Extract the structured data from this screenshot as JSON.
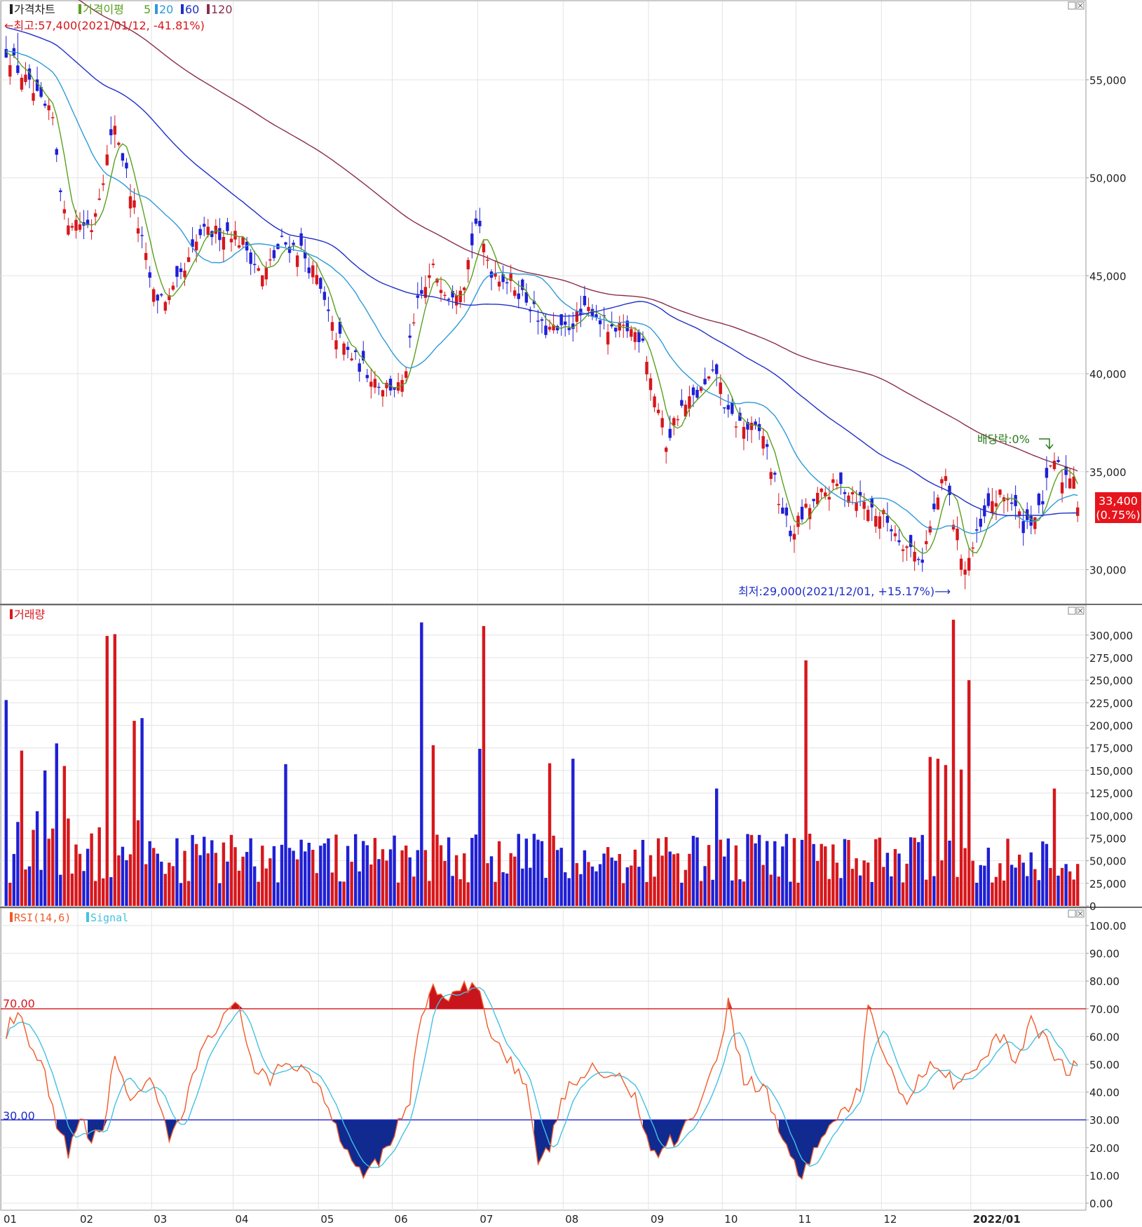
{
  "colors": {
    "up": "#d7171c",
    "down": "#1f1fd6",
    "ma5": "#5aa020",
    "ma20": "#2e9ad8",
    "ma60": "#1f2ec8",
    "ma120": "#8a2e4a",
    "rsi": "#f15a29",
    "signal": "#44c1e0",
    "over70": "#c8141c",
    "under30": "#102a90",
    "grid": "#e3e3e3",
    "frame": "#9a9a9a",
    "text": "#222222"
  },
  "price_panel": {
    "legend": {
      "chart_label": "가격차트",
      "ma_label": "가격이평",
      "ma5": "5",
      "ma20": "20",
      "ma60": "60",
      "ma120": "120"
    },
    "high_label": "←최고:57,400(2021/01/12, -41.81%)",
    "low_label": "최저:29,000(2021/12/01, +15.17%)⟶",
    "dividend_label": "배당락:0%",
    "current_price": "33,400",
    "current_change": "(0.75%)",
    "ytick_labels": [
      "55,000",
      "50,000",
      "45,000",
      "40,000",
      "35,000",
      "30,000"
    ]
  },
  "volume_panel": {
    "legend": "거래량",
    "ytick_labels": [
      "300,000",
      "275,000",
      "250,000",
      "225,000",
      "200,000",
      "175,000",
      "150,000",
      "125,000",
      "100,000",
      "75,000",
      "50,000",
      "25,000",
      "0"
    ]
  },
  "rsi_panel": {
    "legend_rsi": "RSI(14,6)",
    "legend_signal": "Signal",
    "level_70": "70.00",
    "level_30": "30.00",
    "ytick_labels": [
      "100.00",
      "90.00",
      "80.00",
      "70.00",
      "60.00",
      "50.00",
      "40.00",
      "30.00",
      "20.00",
      "10.00",
      "0.00"
    ]
  },
  "x_labels": [
    "01",
    "02",
    "03",
    "04",
    "05",
    "06",
    "07",
    "08",
    "09",
    "10",
    "11",
    "12",
    "2022/01"
  ],
  "chart_data": [
    {
      "type": "candlestick",
      "title": "가격차트",
      "ylim": [
        28300,
        58000
      ],
      "yticks": [
        30000,
        35000,
        40000,
        45000,
        50000,
        55000
      ],
      "x": [
        "2021-01",
        "2021-02",
        "2021-03",
        "2021-04",
        "2021-05",
        "2021-06",
        "2021-07",
        "2021-08",
        "2021-09",
        "2021-10",
        "2021-11",
        "2021-12",
        "2022-01"
      ],
      "close_profile": [
        {
          "x": 0,
          "y": 56500
        },
        {
          "x": 8,
          "y": 54000
        },
        {
          "x": 12,
          "y": 53000
        },
        {
          "x": 15,
          "y": 48000
        },
        {
          "x": 22,
          "y": 47500
        },
        {
          "x": 28,
          "y": 52800
        },
        {
          "x": 33,
          "y": 48500
        },
        {
          "x": 38,
          "y": 44000
        },
        {
          "x": 42,
          "y": 43800
        },
        {
          "x": 46,
          "y": 45200
        },
        {
          "x": 50,
          "y": 47100
        },
        {
          "x": 58,
          "y": 47300
        },
        {
          "x": 62,
          "y": 46400
        },
        {
          "x": 66,
          "y": 44900
        },
        {
          "x": 71,
          "y": 46700
        },
        {
          "x": 76,
          "y": 46300
        },
        {
          "x": 80,
          "y": 44800
        },
        {
          "x": 84,
          "y": 42300
        },
        {
          "x": 88,
          "y": 41100
        },
        {
          "x": 92,
          "y": 40300
        },
        {
          "x": 97,
          "y": 39400
        },
        {
          "x": 102,
          "y": 39300
        },
        {
          "x": 106,
          "y": 43500
        },
        {
          "x": 110,
          "y": 45300
        },
        {
          "x": 114,
          "y": 44100
        },
        {
          "x": 118,
          "y": 44800
        },
        {
          "x": 121,
          "y": 47700
        },
        {
          "x": 125,
          "y": 45300
        },
        {
          "x": 130,
          "y": 44700
        },
        {
          "x": 135,
          "y": 43600
        },
        {
          "x": 138,
          "y": 42300
        },
        {
          "x": 143,
          "y": 42100
        },
        {
          "x": 148,
          "y": 43000
        },
        {
          "x": 151,
          "y": 43300
        },
        {
          "x": 156,
          "y": 42000
        },
        {
          "x": 160,
          "y": 42300
        },
        {
          "x": 164,
          "y": 41900
        },
        {
          "x": 166,
          "y": 39800
        },
        {
          "x": 170,
          "y": 36500
        },
        {
          "x": 173,
          "y": 38000
        },
        {
          "x": 180,
          "y": 39300
        },
        {
          "x": 183,
          "y": 40100
        },
        {
          "x": 186,
          "y": 37800
        },
        {
          "x": 190,
          "y": 37300
        },
        {
          "x": 195,
          "y": 36900
        },
        {
          "x": 199,
          "y": 33600
        },
        {
          "x": 202,
          "y": 31800
        },
        {
          "x": 206,
          "y": 33000
        },
        {
          "x": 210,
          "y": 33800
        },
        {
          "x": 214,
          "y": 34300
        },
        {
          "x": 218,
          "y": 34000
        },
        {
          "x": 222,
          "y": 33200
        },
        {
          "x": 226,
          "y": 32700
        },
        {
          "x": 232,
          "y": 31200
        },
        {
          "x": 236,
          "y": 30600
        },
        {
          "x": 240,
          "y": 33700
        },
        {
          "x": 242,
          "y": 34700
        },
        {
          "x": 244,
          "y": 32500
        },
        {
          "x": 247,
          "y": 30100
        },
        {
          "x": 250,
          "y": 31600
        },
        {
          "x": 254,
          "y": 33500
        },
        {
          "x": 258,
          "y": 33800
        },
        {
          "x": 262,
          "y": 32300
        },
        {
          "x": 266,
          "y": 32900
        },
        {
          "x": 270,
          "y": 35600
        },
        {
          "x": 272,
          "y": 34700
        },
        {
          "x": 275,
          "y": 35000
        },
        {
          "x": 276,
          "y": 33400
        }
      ],
      "moving_averages": [
        {
          "name": "5",
          "period": 5
        },
        {
          "name": "20",
          "period": 20
        },
        {
          "name": "60",
          "period": 60
        },
        {
          "name": "120",
          "period": 120
        }
      ],
      "annotations": [
        {
          "text": "←최고:57,400(2021/01/12, -41.81%)",
          "value": 57400,
          "date": "2021-01-12"
        },
        {
          "text": "최저:29,000(2021/12/01, +15.17%)⟶",
          "value": 29000,
          "date": "2021-12-01"
        },
        {
          "text": "배당락:0%"
        },
        {
          "text": "33,400 (0.75%)",
          "value": 33400
        }
      ]
    },
    {
      "type": "bar",
      "title": "거래량",
      "ylim": [
        0,
        320000
      ],
      "yticks": [
        0,
        25000,
        50000,
        75000,
        100000,
        125000,
        150000,
        175000,
        200000,
        225000,
        250000,
        275000,
        300000
      ],
      "spikes": [
        {
          "x": 0,
          "value": 228000
        },
        {
          "x": 4,
          "value": 172000
        },
        {
          "x": 10,
          "value": 150000
        },
        {
          "x": 13,
          "value": 180000
        },
        {
          "x": 15,
          "value": 155000
        },
        {
          "x": 26,
          "value": 299000
        },
        {
          "x": 28,
          "value": 301000
        },
        {
          "x": 33,
          "value": 205000
        },
        {
          "x": 35,
          "value": 208000
        },
        {
          "x": 72,
          "value": 157000
        },
        {
          "x": 107,
          "value": 314000
        },
        {
          "x": 110,
          "value": 178000
        },
        {
          "x": 122,
          "value": 174000
        },
        {
          "x": 123,
          "value": 310000
        },
        {
          "x": 140,
          "value": 158000
        },
        {
          "x": 146,
          "value": 163000
        },
        {
          "x": 183,
          "value": 130000
        },
        {
          "x": 206,
          "value": 272000
        },
        {
          "x": 238,
          "value": 165000
        },
        {
          "x": 240,
          "value": 163000
        },
        {
          "x": 242,
          "value": 156000
        },
        {
          "x": 244,
          "value": 317000
        },
        {
          "x": 246,
          "value": 151000
        },
        {
          "x": 248,
          "value": 250000
        },
        {
          "x": 270,
          "value": 130000
        }
      ]
    },
    {
      "type": "line",
      "title": "RSI(14,6)",
      "ylim": [
        0,
        100
      ],
      "yticks": [
        0,
        10,
        20,
        30,
        40,
        50,
        60,
        70,
        80,
        90,
        100
      ],
      "levels": [
        70,
        30
      ],
      "series": [
        {
          "name": "RSI(14,6)",
          "profile": [
            {
              "x": 0,
              "y": 62
            },
            {
              "x": 3,
              "y": 68
            },
            {
              "x": 6,
              "y": 56
            },
            {
              "x": 10,
              "y": 46
            },
            {
              "x": 13,
              "y": 26
            },
            {
              "x": 16,
              "y": 19
            },
            {
              "x": 19,
              "y": 30
            },
            {
              "x": 22,
              "y": 22
            },
            {
              "x": 25,
              "y": 28
            },
            {
              "x": 28,
              "y": 52
            },
            {
              "x": 32,
              "y": 38
            },
            {
              "x": 37,
              "y": 44
            },
            {
              "x": 42,
              "y": 22
            },
            {
              "x": 46,
              "y": 34
            },
            {
              "x": 50,
              "y": 55
            },
            {
              "x": 54,
              "y": 64
            },
            {
              "x": 60,
              "y": 71
            },
            {
              "x": 64,
              "y": 48
            },
            {
              "x": 68,
              "y": 43
            },
            {
              "x": 72,
              "y": 51
            },
            {
              "x": 78,
              "y": 48
            },
            {
              "x": 84,
              "y": 32
            },
            {
              "x": 88,
              "y": 18
            },
            {
              "x": 92,
              "y": 12
            },
            {
              "x": 96,
              "y": 16
            },
            {
              "x": 101,
              "y": 28
            },
            {
              "x": 104,
              "y": 38
            },
            {
              "x": 107,
              "y": 69
            },
            {
              "x": 110,
              "y": 78
            },
            {
              "x": 114,
              "y": 72
            },
            {
              "x": 118,
              "y": 78
            },
            {
              "x": 122,
              "y": 75
            },
            {
              "x": 126,
              "y": 58
            },
            {
              "x": 130,
              "y": 52
            },
            {
              "x": 134,
              "y": 42
            },
            {
              "x": 137,
              "y": 12
            },
            {
              "x": 140,
              "y": 20
            },
            {
              "x": 143,
              "y": 38
            },
            {
              "x": 150,
              "y": 48
            },
            {
              "x": 156,
              "y": 46
            },
            {
              "x": 162,
              "y": 40
            },
            {
              "x": 165,
              "y": 22
            },
            {
              "x": 168,
              "y": 18
            },
            {
              "x": 171,
              "y": 22
            },
            {
              "x": 175,
              "y": 28
            },
            {
              "x": 180,
              "y": 40
            },
            {
              "x": 184,
              "y": 58
            },
            {
              "x": 186,
              "y": 72
            },
            {
              "x": 190,
              "y": 45
            },
            {
              "x": 196,
              "y": 40
            },
            {
              "x": 200,
              "y": 22
            },
            {
              "x": 205,
              "y": 10
            },
            {
              "x": 210,
              "y": 24
            },
            {
              "x": 215,
              "y": 32
            },
            {
              "x": 220,
              "y": 40
            },
            {
              "x": 222,
              "y": 72
            },
            {
              "x": 226,
              "y": 55
            },
            {
              "x": 232,
              "y": 36
            },
            {
              "x": 238,
              "y": 52
            },
            {
              "x": 244,
              "y": 44
            },
            {
              "x": 250,
              "y": 48
            },
            {
              "x": 256,
              "y": 60
            },
            {
              "x": 260,
              "y": 52
            },
            {
              "x": 264,
              "y": 65
            },
            {
              "x": 268,
              "y": 58
            },
            {
              "x": 272,
              "y": 50
            },
            {
              "x": 274,
              "y": 48
            },
            {
              "x": 276,
              "y": 50
            }
          ]
        },
        {
          "name": "Signal",
          "period": 6
        }
      ]
    }
  ]
}
